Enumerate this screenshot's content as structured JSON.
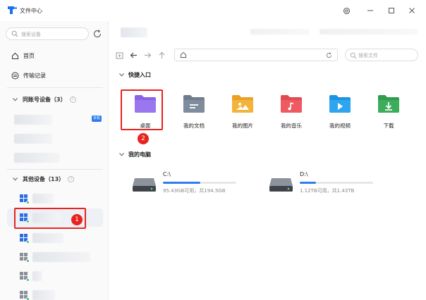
{
  "window": {
    "title": "文件中心"
  },
  "sidebar": {
    "search_placeholder": "搜索设备",
    "nav": [
      {
        "label": "首页",
        "icon": "home-icon"
      },
      {
        "label": "传输记录",
        "icon": "transfer-icon"
      }
    ],
    "groups": [
      {
        "title": "同账号设备（3）",
        "badge": "本机"
      },
      {
        "title": "其他设备（13）"
      }
    ]
  },
  "main": {
    "search_placeholder": "搜索文件",
    "quick_access": {
      "title": "快捷入口",
      "items": [
        {
          "label": "桌面",
          "icon": "desktop-folder-icon",
          "color": "#8a63e6"
        },
        {
          "label": "我的文档",
          "icon": "documents-folder-icon",
          "color": "#7f8c9d"
        },
        {
          "label": "我的图片",
          "icon": "pictures-folder-icon",
          "color": "#f4b43a"
        },
        {
          "label": "我的音乐",
          "icon": "music-folder-icon",
          "color": "#ee5a62"
        },
        {
          "label": "我的视频",
          "icon": "videos-folder-icon",
          "color": "#2fa4ef"
        },
        {
          "label": "下载",
          "icon": "downloads-folder-icon",
          "color": "#3cad5b"
        }
      ]
    },
    "computer": {
      "title": "我的电脑",
      "drives": [
        {
          "name": "C:\\",
          "info": "95.43GB可用，共194.5GB",
          "used_fraction": 0.51
        },
        {
          "name": "D:\\",
          "info": "1.12TB可用，共1.43TB",
          "used_fraction": 0.22
        }
      ]
    }
  },
  "annotations": {
    "step1": "1",
    "step2": "2"
  },
  "colors": {
    "accent": "#2d7df0",
    "annotation": "#e8231f",
    "online": "#3bbf6c"
  }
}
